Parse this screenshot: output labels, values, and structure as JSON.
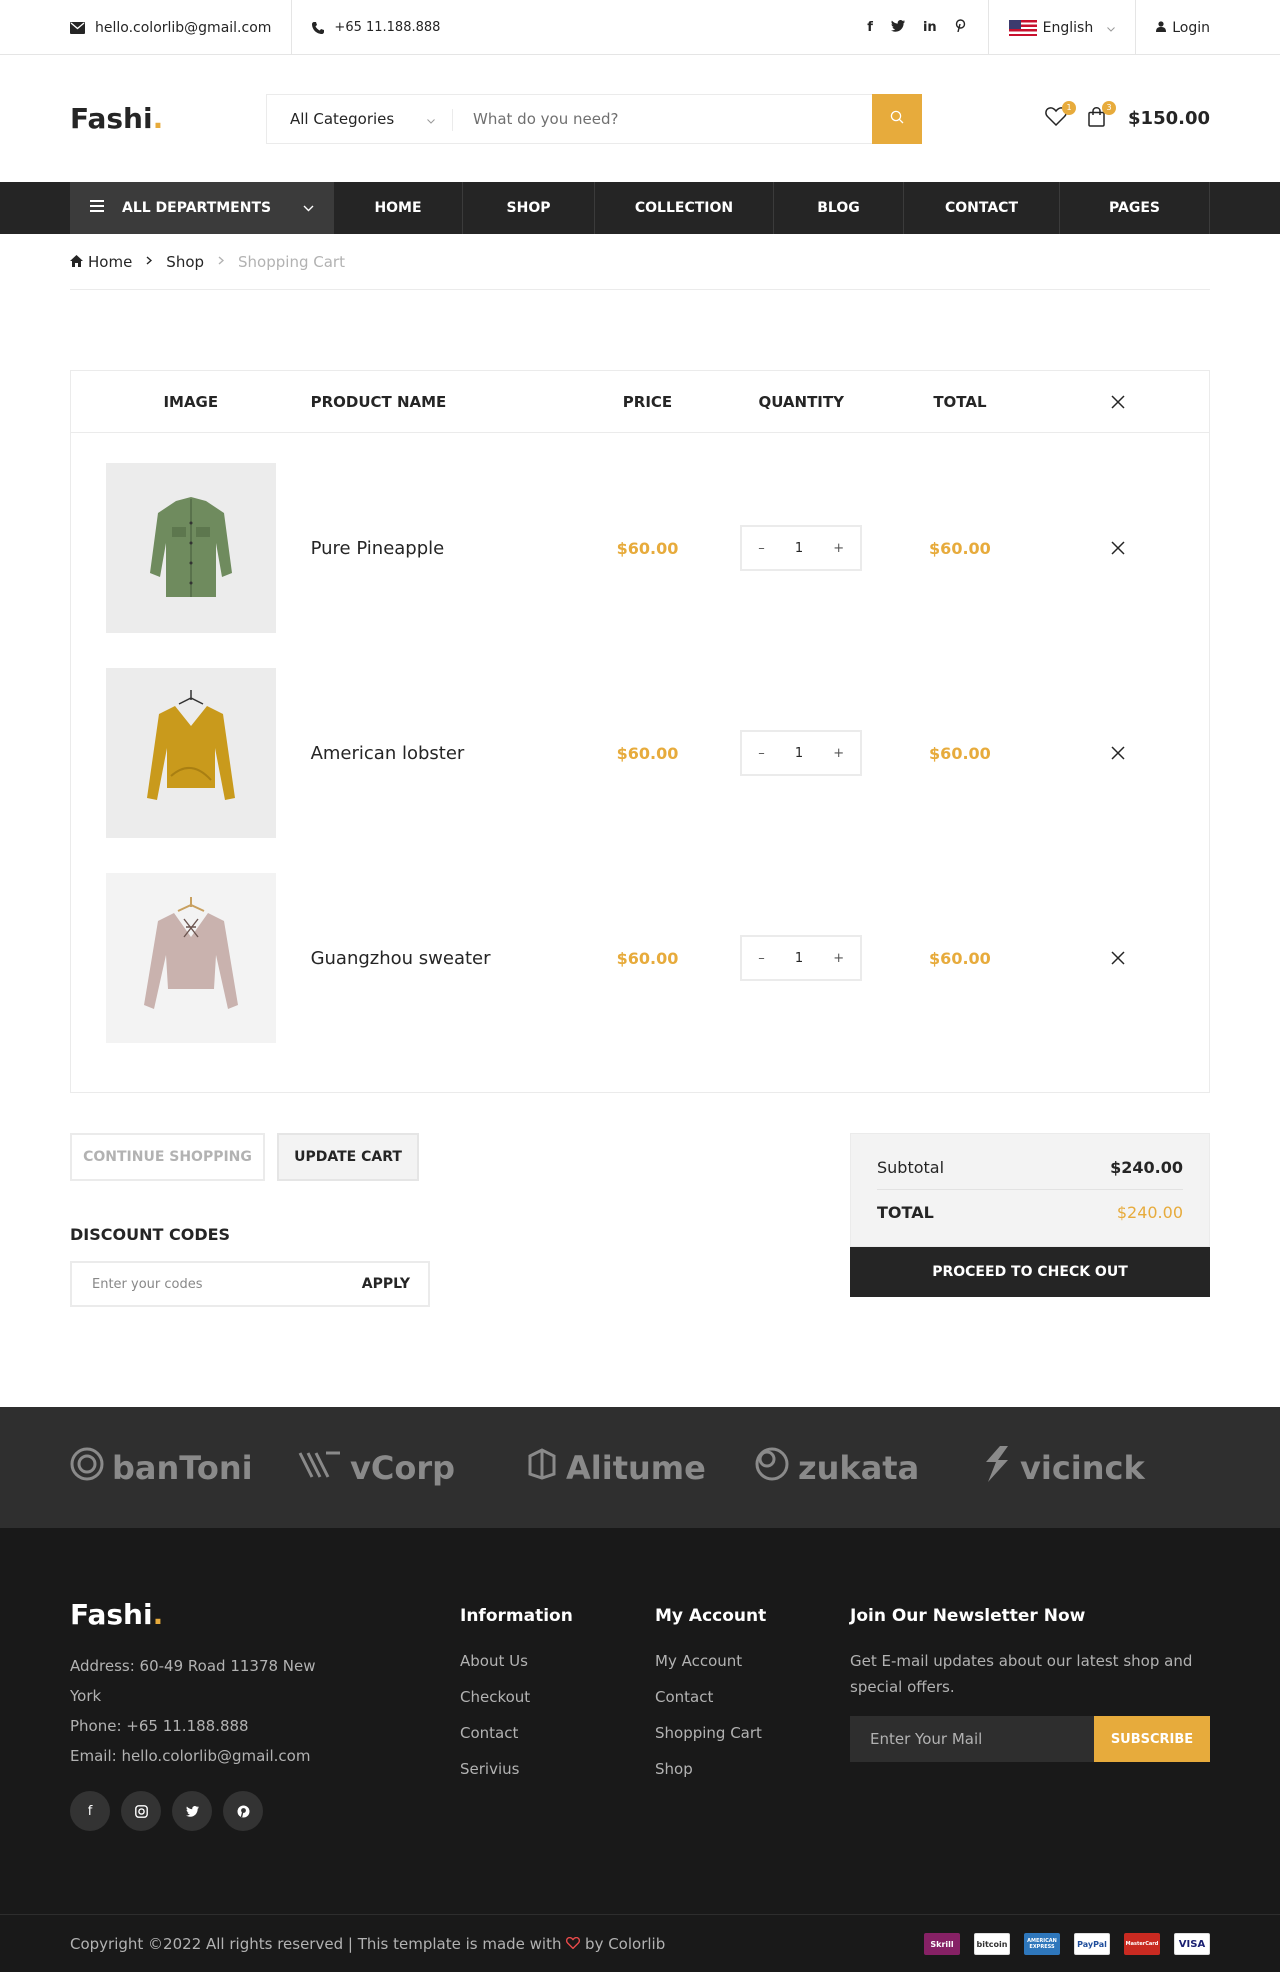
{
  "topbar": {
    "email": "hello.colorlib@gmail.com",
    "phone": "+65 11.188.888",
    "language": "English",
    "login": "Login"
  },
  "header": {
    "logo": "Fashi",
    "logo_dot": ".",
    "category": "All Categories",
    "search_placeholder": "What do you need?",
    "wishlist_count": "1",
    "cart_count": "3",
    "cart_total": "$150.00"
  },
  "nav": {
    "departments": "ALL DEPARTMENTS",
    "items": [
      "HOME",
      "SHOP",
      "COLLECTION",
      "BLOG",
      "CONTACT",
      "PAGES"
    ]
  },
  "breadcrumb": [
    "Home",
    "Shop",
    "Shopping Cart"
  ],
  "cart": {
    "headers": [
      "IMAGE",
      "PRODUCT NAME",
      "PRICE",
      "QUANTITY",
      "TOTAL"
    ],
    "items": [
      {
        "name": "Pure Pineapple",
        "price": "$60.00",
        "qty": "1",
        "total": "$60.00",
        "color": "#6f8b5e"
      },
      {
        "name": "American lobster",
        "price": "$60.00",
        "qty": "1",
        "total": "$60.00",
        "color": "#c99a1c"
      },
      {
        "name": "Guangzhou sweater",
        "price": "$60.00",
        "qty": "1",
        "total": "$60.00",
        "color": "#c9b2ae"
      }
    ],
    "continue_label": "CONTINUE SHOPPING",
    "update_label": "UPDATE CART",
    "discount_title": "DISCOUNT CODES",
    "discount_placeholder": "Enter your codes",
    "apply_label": "APPLY",
    "subtotal_label": "Subtotal",
    "subtotal_value": "$240.00",
    "total_label": "Total",
    "total_value": "$240.00",
    "checkout_label": "PROCEED TO CHECK OUT"
  },
  "partners": [
    "banToni",
    "vCorp",
    "Alitume",
    "zukata",
    "vicinck"
  ],
  "footer": {
    "logo": "Fashi",
    "logo_dot": ".",
    "address": "Address: 60-49 Road 11378 New York",
    "phone": "Phone: +65 11.188.888",
    "email": "Email: hello.colorlib@gmail.com",
    "info_title": "Information",
    "info_links": [
      "About Us",
      "Checkout",
      "Contact",
      "Serivius"
    ],
    "account_title": "My Account",
    "account_links": [
      "My Account",
      "Contact",
      "Shopping Cart",
      "Shop"
    ],
    "news_title": "Join Our Newsletter Now",
    "news_text": "Get E-mail updates about our latest shop and special offers.",
    "news_placeholder": "Enter Your Mail",
    "subscribe_label": "SUBSCRIBE",
    "copyright_before": "Copyright ©2022 All rights reserved | This template is made with",
    "copyright_after": "by Colorlib",
    "payments": [
      "Skrill",
      "bitcoin",
      "AMERICAN EXPRESS",
      "PayPal",
      "MasterCard",
      "VISA"
    ]
  },
  "colors": {
    "accent": "#e7ab3c",
    "dark": "#252525"
  }
}
